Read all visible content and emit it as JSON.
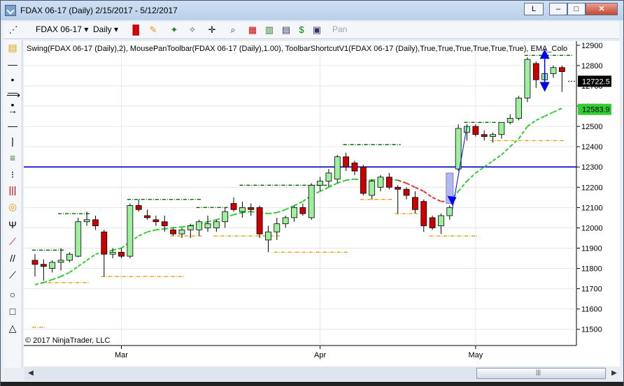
{
  "window": {
    "title": "FDAX 06-17 (Daily)  2/15/2017 - 5/12/2017",
    "btn_l": "L",
    "btn_min": "–",
    "btn_max": "□",
    "btn_close": "✕"
  },
  "toolbar": {
    "instrument": "FDAX 06-17",
    "interval": "Daily",
    "pan": "Pan"
  },
  "indicator_label": "Swing(FDAX 06-17 (Daily),2), MousePanToolbar(FDAX 06-17 (Daily),1.00), ToolbarShortcutV1(FDAX 06-17 (Daily),True,True,True,True,True,True), EMA_Colo",
  "copyright": "© 2017 NinjaTrader, LLC",
  "colors": {
    "up": "#9df09d",
    "down": "#cc0000",
    "ema": "#33cc33",
    "ema_down": "#dd3333",
    "swing_high": "#006600",
    "swing_low": "#ee9900",
    "hline": "#0000cc",
    "arrow": "#0000ee"
  },
  "chart_data": {
    "type": "candlestick",
    "y_range": [
      11420,
      12920
    ],
    "y_ticks": [
      11500,
      11600,
      11700,
      11800,
      11900,
      12000,
      12100,
      12200,
      12300,
      12400,
      12500,
      12600,
      12700,
      12800,
      12900
    ],
    "x_labels": [
      {
        "label": "Mar",
        "index": 10
      },
      {
        "label": "Apr",
        "index": 33
      },
      {
        "label": "May",
        "index": 51
      }
    ],
    "last_price": 12722.5,
    "ema_value": 12583.9,
    "horizontal_line": 12300,
    "candles": [
      {
        "o": 11840,
        "h": 11870,
        "l": 11760,
        "c": 11820
      },
      {
        "o": 11820,
        "h": 11845,
        "l": 11740,
        "c": 11810
      },
      {
        "o": 11800,
        "h": 11840,
        "l": 11780,
        "c": 11830
      },
      {
        "o": 11830,
        "h": 11900,
        "l": 11790,
        "c": 11840
      },
      {
        "o": 11840,
        "h": 11880,
        "l": 11830,
        "c": 11870
      },
      {
        "o": 11860,
        "h": 12050,
        "l": 11855,
        "c": 12030
      },
      {
        "o": 12030,
        "h": 12080,
        "l": 12010,
        "c": 12040
      },
      {
        "o": 12040,
        "h": 12060,
        "l": 11990,
        "c": 12010
      },
      {
        "o": 11980,
        "h": 11990,
        "l": 11760,
        "c": 11870
      },
      {
        "o": 11870,
        "h": 11900,
        "l": 11850,
        "c": 11880
      },
      {
        "o": 11880,
        "h": 11900,
        "l": 11850,
        "c": 11860
      },
      {
        "o": 11860,
        "h": 12120,
        "l": 11850,
        "c": 12110
      },
      {
        "o": 12110,
        "h": 12140,
        "l": 12080,
        "c": 12090
      },
      {
        "o": 12060,
        "h": 12090,
        "l": 12040,
        "c": 12050
      },
      {
        "o": 12040,
        "h": 12060,
        "l": 12010,
        "c": 12030
      },
      {
        "o": 12030,
        "h": 12060,
        "l": 11980,
        "c": 12010
      },
      {
        "o": 11990,
        "h": 12000,
        "l": 11960,
        "c": 11970
      },
      {
        "o": 11970,
        "h": 12000,
        "l": 11950,
        "c": 11990
      },
      {
        "o": 11990,
        "h": 12020,
        "l": 11950,
        "c": 12010
      },
      {
        "o": 11990,
        "h": 12040,
        "l": 11960,
        "c": 12030
      },
      {
        "o": 12000,
        "h": 12060,
        "l": 11980,
        "c": 12020
      },
      {
        "o": 12000,
        "h": 12040,
        "l": 11980,
        "c": 12030
      },
      {
        "o": 12030,
        "h": 12100,
        "l": 12000,
        "c": 12080
      },
      {
        "o": 12120,
        "h": 12150,
        "l": 12080,
        "c": 12090
      },
      {
        "o": 12080,
        "h": 12130,
        "l": 12050,
        "c": 12100
      },
      {
        "o": 12100,
        "h": 12120,
        "l": 12060,
        "c": 12090
      },
      {
        "o": 12100,
        "h": 12110,
        "l": 11950,
        "c": 11970
      },
      {
        "o": 11940,
        "h": 12010,
        "l": 11880,
        "c": 11980
      },
      {
        "o": 11980,
        "h": 12050,
        "l": 11940,
        "c": 12020
      },
      {
        "o": 12020,
        "h": 12060,
        "l": 12000,
        "c": 12050
      },
      {
        "o": 12050,
        "h": 12110,
        "l": 12030,
        "c": 12100
      },
      {
        "o": 12100,
        "h": 12120,
        "l": 12060,
        "c": 12070
      },
      {
        "o": 12050,
        "h": 12220,
        "l": 12040,
        "c": 12210
      },
      {
        "o": 12210,
        "h": 12250,
        "l": 12180,
        "c": 12230
      },
      {
        "o": 12230,
        "h": 12290,
        "l": 12200,
        "c": 12270
      },
      {
        "o": 12240,
        "h": 12360,
        "l": 12220,
        "c": 12350
      },
      {
        "o": 12350,
        "h": 12370,
        "l": 12280,
        "c": 12300
      },
      {
        "o": 12320,
        "h": 12330,
        "l": 12260,
        "c": 12280
      },
      {
        "o": 12300,
        "h": 12310,
        "l": 12160,
        "c": 12170
      },
      {
        "o": 12160,
        "h": 12240,
        "l": 12140,
        "c": 12230
      },
      {
        "o": 12200,
        "h": 12260,
        "l": 12180,
        "c": 12250
      },
      {
        "o": 12250,
        "h": 12270,
        "l": 12190,
        "c": 12200
      },
      {
        "o": 12200,
        "h": 12210,
        "l": 12070,
        "c": 12190
      },
      {
        "o": 12190,
        "h": 12200,
        "l": 12140,
        "c": 12160
      },
      {
        "o": 12150,
        "h": 12180,
        "l": 12070,
        "c": 12090
      },
      {
        "o": 12130,
        "h": 12140,
        "l": 11980,
        "c": 12010
      },
      {
        "o": 12050,
        "h": 12060,
        "l": 11990,
        "c": 12000
      },
      {
        "o": 12010,
        "h": 12070,
        "l": 11970,
        "c": 12060
      },
      {
        "o": 12060,
        "h": 12110,
        "l": 12040,
        "c": 12100
      },
      {
        "o": 12290,
        "h": 12510,
        "l": 12280,
        "c": 12490
      },
      {
        "o": 12470,
        "h": 12510,
        "l": 12430,
        "c": 12500
      },
      {
        "o": 12500,
        "h": 12510,
        "l": 12450,
        "c": 12460
      },
      {
        "o": 12460,
        "h": 12480,
        "l": 12430,
        "c": 12450
      },
      {
        "o": 12450,
        "h": 12470,
        "l": 12420,
        "c": 12460
      },
      {
        "o": 12460,
        "h": 12520,
        "l": 12440,
        "c": 12520
      },
      {
        "o": 12520,
        "h": 12560,
        "l": 12510,
        "c": 12540
      },
      {
        "o": 12540,
        "h": 12650,
        "l": 12530,
        "c": 12640
      },
      {
        "o": 12640,
        "h": 12840,
        "l": 12620,
        "c": 12830
      },
      {
        "o": 12810,
        "h": 12820,
        "l": 12690,
        "c": 12730
      },
      {
        "o": 12730,
        "h": 12780,
        "l": 12720,
        "c": 12760
      },
      {
        "o": 12760,
        "h": 12800,
        "l": 12740,
        "c": 12790
      },
      {
        "o": 12790,
        "h": 12800,
        "l": 12670,
        "c": 12770
      }
    ],
    "ema": [
      11720,
      11730,
      11745,
      11760,
      11780,
      11810,
      11840,
      11870,
      11880,
      11890,
      11900,
      11930,
      11960,
      11980,
      11990,
      11995,
      12000,
      12005,
      12010,
      12020,
      12030,
      12040,
      12050,
      12065,
      12075,
      12080,
      12075,
      12070,
      12075,
      12090,
      12110,
      12130,
      12160,
      12180,
      12200,
      12220,
      12235,
      12240,
      12235,
      12235,
      12240,
      12240,
      12235,
      12220,
      12200,
      12180,
      12150,
      12130,
      12130,
      12180,
      12230,
      12270,
      12300,
      12330,
      12360,
      12400,
      12440,
      12500,
      12530,
      12550,
      12570,
      12590
    ],
    "ema_down_range": [
      42,
      48
    ],
    "swing_highs": [
      {
        "y": 11890,
        "from": 0,
        "to": 3
      },
      {
        "y": 12070,
        "from": 3,
        "to": 6
      },
      {
        "y": 12140,
        "from": 11,
        "to": 19
      },
      {
        "y": 12100,
        "from": 19,
        "to": 22
      },
      {
        "y": 12210,
        "from": 24,
        "to": 34
      },
      {
        "y": 12410,
        "from": 36,
        "to": 42
      },
      {
        "y": 12520,
        "from": 50,
        "to": 53
      },
      {
        "y": 12850,
        "from": 57,
        "to": 62
      }
    ],
    "swing_lows": [
      {
        "y": 11510,
        "from": 0,
        "to": 1
      },
      {
        "y": 11730,
        "from": 1,
        "to": 6
      },
      {
        "y": 11760,
        "from": 8,
        "to": 17
      },
      {
        "y": 11960,
        "from": 16,
        "to": 19
      },
      {
        "y": 11960,
        "from": 21,
        "to": 28
      },
      {
        "y": 11880,
        "from": 28,
        "to": 36
      },
      {
        "y": 12140,
        "from": 38,
        "to": 41
      },
      {
        "y": 12070,
        "from": 42,
        "to": 44
      },
      {
        "y": 11960,
        "from": 46,
        "to": 51
      },
      {
        "y": 12430,
        "from": 53,
        "to": 61
      }
    ],
    "highlight_bar": {
      "index": 48,
      "low": 12120,
      "high": 12270
    },
    "arrows": [
      {
        "from_index": 50,
        "from_y": 12500,
        "to_index": 48.3,
        "to_y": 12110
      },
      {
        "index": 59,
        "dir": "up",
        "y": 12730
      },
      {
        "index": 59,
        "dir": "down",
        "y": 12760
      }
    ]
  }
}
